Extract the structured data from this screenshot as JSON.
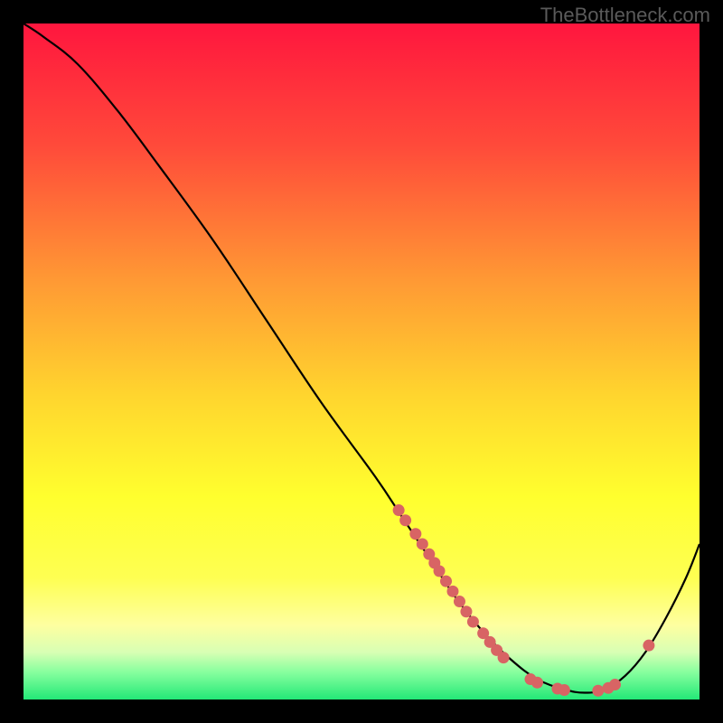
{
  "watermark": "TheBottleneck.com",
  "chart_data": {
    "type": "line",
    "title": "",
    "xlabel": "",
    "ylabel": "",
    "xlim": [
      0,
      100
    ],
    "ylim": [
      0,
      100
    ],
    "grid": false,
    "curve": [
      {
        "x": 0,
        "y": 100
      },
      {
        "x": 3,
        "y": 98
      },
      {
        "x": 8,
        "y": 94
      },
      {
        "x": 14,
        "y": 87
      },
      {
        "x": 20,
        "y": 79
      },
      {
        "x": 28,
        "y": 68
      },
      {
        "x": 36,
        "y": 56
      },
      {
        "x": 44,
        "y": 44
      },
      {
        "x": 52,
        "y": 33
      },
      {
        "x": 56,
        "y": 27
      },
      {
        "x": 60,
        "y": 21
      },
      {
        "x": 64,
        "y": 15
      },
      {
        "x": 68,
        "y": 10
      },
      {
        "x": 72,
        "y": 6
      },
      {
        "x": 76,
        "y": 3
      },
      {
        "x": 80,
        "y": 1.5
      },
      {
        "x": 83,
        "y": 1
      },
      {
        "x": 86,
        "y": 1.5
      },
      {
        "x": 89,
        "y": 3.5
      },
      {
        "x": 92,
        "y": 7
      },
      {
        "x": 95,
        "y": 12
      },
      {
        "x": 98,
        "y": 18
      },
      {
        "x": 100,
        "y": 23
      }
    ],
    "dots": [
      {
        "x": 55.5,
        "y": 28
      },
      {
        "x": 56.5,
        "y": 26.5
      },
      {
        "x": 58,
        "y": 24.5
      },
      {
        "x": 59,
        "y": 23
      },
      {
        "x": 60,
        "y": 21.5
      },
      {
        "x": 60.8,
        "y": 20.2
      },
      {
        "x": 61.5,
        "y": 19
      },
      {
        "x": 62.5,
        "y": 17.5
      },
      {
        "x": 63.5,
        "y": 16
      },
      {
        "x": 64.5,
        "y": 14.5
      },
      {
        "x": 65.5,
        "y": 13
      },
      {
        "x": 66.5,
        "y": 11.5
      },
      {
        "x": 68,
        "y": 9.8
      },
      {
        "x": 69,
        "y": 8.5
      },
      {
        "x": 70,
        "y": 7.3
      },
      {
        "x": 71,
        "y": 6.2
      },
      {
        "x": 75,
        "y": 3
      },
      {
        "x": 76,
        "y": 2.5
      },
      {
        "x": 79,
        "y": 1.6
      },
      {
        "x": 80,
        "y": 1.4
      },
      {
        "x": 85,
        "y": 1.3
      },
      {
        "x": 86.5,
        "y": 1.7
      },
      {
        "x": 87.5,
        "y": 2.2
      },
      {
        "x": 92.5,
        "y": 8
      }
    ],
    "gradient_stops": [
      {
        "offset": 0,
        "color": "#ff163e"
      },
      {
        "offset": 18,
        "color": "#ff4a3a"
      },
      {
        "offset": 38,
        "color": "#ff9934"
      },
      {
        "offset": 55,
        "color": "#ffd52e"
      },
      {
        "offset": 70,
        "color": "#ffff2e"
      },
      {
        "offset": 82,
        "color": "#feff52"
      },
      {
        "offset": 89,
        "color": "#feffa0"
      },
      {
        "offset": 93,
        "color": "#d8ffb4"
      },
      {
        "offset": 96,
        "color": "#86ff9e"
      },
      {
        "offset": 100,
        "color": "#23e877"
      }
    ],
    "curve_color": "#000000",
    "dot_color": "#d86464"
  }
}
